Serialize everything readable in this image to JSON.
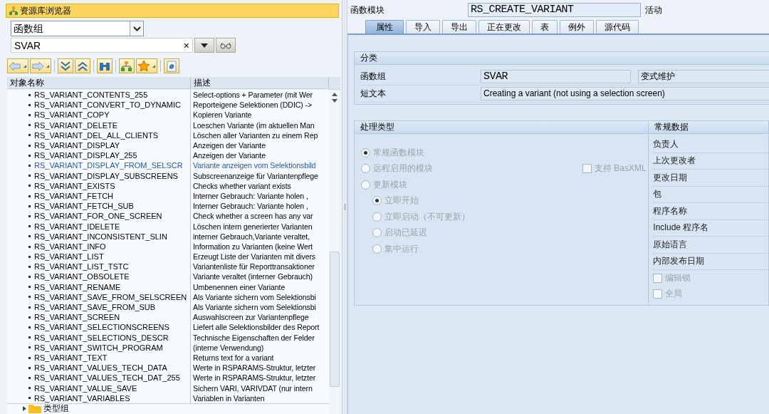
{
  "repository_browser": {
    "title": "资源库浏览器",
    "object_type": {
      "value": "函数组"
    },
    "search": {
      "value": "SVAR",
      "clear": "×"
    },
    "table": {
      "columns": [
        "对象名称",
        "描述"
      ],
      "rows": [
        {
          "name": "RS_VARIANT_CONTENTS_255",
          "description": "Select-options + Parameter (mit Wer",
          "selected": false
        },
        {
          "name": "RS_VARIANT_CONVERT_TO_DYNAMIC",
          "description": "Reporteigene Selektionen (DDIC) ->",
          "selected": false
        },
        {
          "name": "RS_VARIANT_COPY",
          "description": "Kopieren Variante",
          "selected": false
        },
        {
          "name": "RS_VARIANT_DELETE",
          "description": "Loeschen Variante (im aktuellen Man",
          "selected": false
        },
        {
          "name": "RS_VARIANT_DEL_ALL_CLIENTS",
          "description": "Löschen aller Varianten zu einem Rep",
          "selected": false
        },
        {
          "name": "RS_VARIANT_DISPLAY",
          "description": "Anzeigen der Variante",
          "selected": false
        },
        {
          "name": "RS_VARIANT_DISPLAY_255",
          "description": "Anzeigen der Variante",
          "selected": false
        },
        {
          "name": "RS_VARIANT_DISPLAY_FROM_SELSCR",
          "description": "Variante anzeigen vom Selektionsbild",
          "selected": true
        },
        {
          "name": "RS_VARIANT_DISPLAY_SUBSCREENS",
          "description": "Subscreenanzeige für Variantenpflege",
          "selected": false
        },
        {
          "name": "RS_VARIANT_EXISTS",
          "description": "Checks whether variant exists",
          "selected": false
        },
        {
          "name": "RS_VARIANT_FETCH",
          "description": "Interner Gebrauch: Variante holen ,",
          "selected": false
        },
        {
          "name": "RS_VARIANT_FETCH_SUB",
          "description": "Interner Gebrauch: Variante holen ,",
          "selected": false
        },
        {
          "name": "RS_VARIANT_FOR_ONE_SCREEN",
          "description": "Check whether a screen has any var",
          "selected": false
        },
        {
          "name": "RS_VARIANT_IDELETE",
          "description": "Löschen intern generierter Varianten",
          "selected": false
        },
        {
          "name": "RS_VARIANT_INCONSISTENT_SLIN",
          "description": "interner Gebrauch,Variante veraltet,",
          "selected": false
        },
        {
          "name": "RS_VARIANT_INFO",
          "description": "Information zu Varianten (keine Wert",
          "selected": false
        },
        {
          "name": "RS_VARIANT_LIST",
          "description": "Erzeugt Liste der Varianten mit divers",
          "selected": false
        },
        {
          "name": "RS_VARIANT_LIST_TSTC",
          "description": "Variantenliste für Reporttransaktioner",
          "selected": false
        },
        {
          "name": "RS_VARIANT_OBSOLETE",
          "description": "Variante veraltet (interner Gebrauch)",
          "selected": false
        },
        {
          "name": "RS_VARIANT_RENAME",
          "description": "Umbenennen einer Variante",
          "selected": false
        },
        {
          "name": "RS_VARIANT_SAVE_FROM_SELSCREEN",
          "description": "Als Variante sichern vom Selektionsbi",
          "selected": false
        },
        {
          "name": "RS_VARIANT_SAVE_FROM_SUB",
          "description": "Als Variante sichern vom Selektionsbi",
          "selected": false
        },
        {
          "name": "RS_VARIANT_SCREEN",
          "description": "Auswahlscreen zur Variantenpflege",
          "selected": false
        },
        {
          "name": "RS_VARIANT_SELECTIONSCREENS",
          "description": "Liefert alle Selektionsbilder des Report",
          "selected": false
        },
        {
          "name": "RS_VARIANT_SELECTIONS_DESCR",
          "description": "Technische Eigenschaften der Felder",
          "selected": false
        },
        {
          "name": "RS_VARIANT_SWITCH_PROGRAM",
          "description": "(interne Verwendung)",
          "selected": false
        },
        {
          "name": "RS_VARIANT_TEXT",
          "description": "Returns text for a variant",
          "selected": false
        },
        {
          "name": "RS_VARIANT_VALUES_TECH_DATA",
          "description": "Werte in RSPARAMS-Struktur, letzter",
          "selected": false
        },
        {
          "name": "RS_VARIANT_VALUES_TECH_DAT_255",
          "description": "Werte in RSPARAMS-Struktur, letzter",
          "selected": false
        },
        {
          "name": "RS_VARIANT_VALUE_SAVE",
          "description": "Sichern VARI, VARIVDAT (nur intern",
          "selected": false
        },
        {
          "name": "RS_VARIANT_VARIABLES",
          "description": "Variablen in Varianten",
          "selected": false
        }
      ],
      "folder_row": {
        "label": "类型组"
      }
    }
  },
  "function_module": {
    "label": "函数模块",
    "name": "RS_CREATE_VARIANT",
    "status": "活动",
    "tabs": [
      {
        "label": "属性",
        "selected": true
      },
      {
        "label": "导入",
        "selected": false
      },
      {
        "label": "导出",
        "selected": false
      },
      {
        "label": "正在更改",
        "selected": false
      },
      {
        "label": "表",
        "selected": false
      },
      {
        "label": "例外",
        "selected": false
      },
      {
        "label": "源代码",
        "selected": false
      }
    ],
    "classification": {
      "title": "分类",
      "rows": [
        {
          "label": "函数组",
          "values": [
            "SVAR",
            "变式维护"
          ]
        },
        {
          "label": "短文本",
          "values": [
            "Creating a variant (not using a selection screen)"
          ]
        }
      ]
    },
    "processing_type": {
      "title": "处理类型",
      "options": [
        {
          "label": "常规函数模块",
          "selected": true,
          "disabled": true
        },
        {
          "label": "远程启用的模块",
          "selected": false,
          "disabled": true
        },
        {
          "label": "更新模块",
          "selected": false,
          "disabled": true,
          "children": [
            {
              "label": "立即开始",
              "selected": true,
              "disabled": true
            },
            {
              "label": "立即启动（不可更新）",
              "selected": false,
              "disabled": true
            },
            {
              "label": "启动已延迟",
              "selected": false,
              "disabled": true
            },
            {
              "label": "集中运行",
              "selected": false,
              "disabled": true
            }
          ]
        }
      ],
      "basxml": {
        "label": "支持 BasXML",
        "checked": false,
        "disabled": true
      }
    },
    "general_data": {
      "title": "常规数据",
      "fields": [
        {
          "kind": "field",
          "label": "负责人"
        },
        {
          "kind": "field",
          "label": "上次更改者"
        },
        {
          "kind": "field",
          "label": "更改日期"
        },
        {
          "kind": "field",
          "label": "包"
        },
        {
          "kind": "field",
          "label": "程序名称"
        },
        {
          "kind": "field",
          "label": "Include 程序名"
        },
        {
          "kind": "field",
          "label": "原始语言"
        },
        {
          "kind": "field",
          "label": "内部发布日期"
        },
        {
          "kind": "checkbox",
          "label": "编辑锁",
          "checked": false,
          "disabled": true
        },
        {
          "kind": "checkbox",
          "label": "全局",
          "checked": false,
          "disabled": true
        }
      ]
    }
  }
}
